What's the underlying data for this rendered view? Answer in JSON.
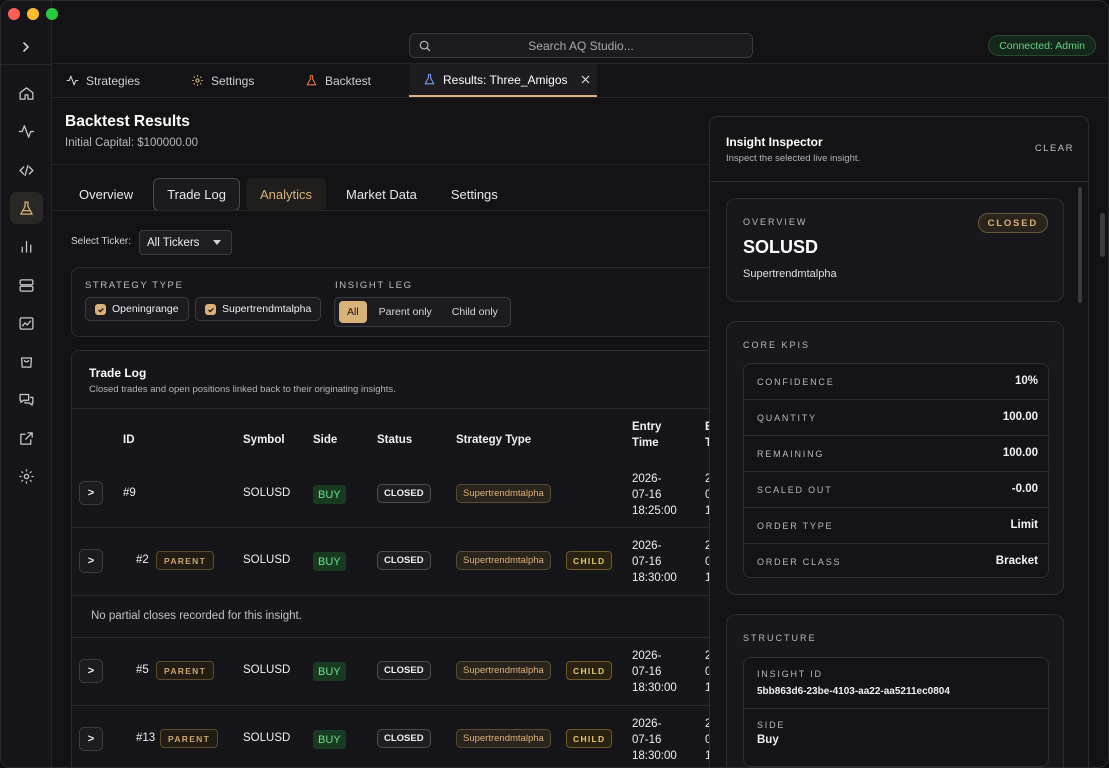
{
  "sidebar": {
    "toggle_icon": "chevron-right-icon",
    "items": [
      {
        "icon": "home-icon"
      },
      {
        "icon": "activity-icon"
      },
      {
        "icon": "code-icon"
      },
      {
        "icon": "flask-icon",
        "active": true
      },
      {
        "icon": "bar-chart-icon"
      },
      {
        "icon": "server-icon"
      },
      {
        "icon": "line-chart-icon"
      },
      {
        "icon": "shopping-bag-icon"
      },
      {
        "icon": "chat-icon"
      },
      {
        "icon": "external-link-icon"
      },
      {
        "icon": "gear-icon"
      }
    ]
  },
  "topbar": {
    "search_placeholder": "Search AQ Studio...",
    "connection": "Connected: Admin"
  },
  "main_tabs": [
    {
      "label": "Strategies",
      "icon": "activity-icon"
    },
    {
      "label": "Settings",
      "icon": "gear-icon"
    },
    {
      "label": "Backtest",
      "icon": "flask-icon"
    },
    {
      "label": "Results: Three_Amigos",
      "icon": "flask-icon",
      "active": true
    }
  ],
  "header": {
    "title": "Backtest Results",
    "subtitle": "Initial Capital: $100000.00"
  },
  "sub_tabs": [
    "Overview",
    "Trade Log",
    "Analytics",
    "Market Data",
    "Settings"
  ],
  "ticker": {
    "label": "Select Ticker:",
    "value": "All Tickers"
  },
  "filters": {
    "strategy_label": "STRATEGY TYPE",
    "strategies": [
      "Openingrange",
      "Supertrendmtalpha"
    ],
    "leg_label": "INSIGHT LEG",
    "legs": [
      "All",
      "Parent only",
      "Child only"
    ]
  },
  "trade_log": {
    "title": "Trade Log",
    "subtitle": "Closed trades and open positions linked back to their originating insights.",
    "headers": {
      "id": "ID",
      "symbol": "Symbol",
      "side": "Side",
      "status": "Status",
      "strategy": "Strategy Type",
      "entry_1": "Entry",
      "entry_2": "Time",
      "exit_1": "E",
      "exit_2": "T"
    },
    "expander": ">",
    "parent_badge": "PARENT",
    "child_badge": "CHILD",
    "empty_note": "No partial closes recorded for this insight.",
    "rows": [
      {
        "id": "#9",
        "symbol": "SOLUSD",
        "side": "BUY",
        "status": "CLOSED",
        "strategy": "Supertrendmtalpha",
        "entry_date": "2026-",
        "entry_md": "07-16",
        "entry_time": "18:25:00",
        "exit_a": "2",
        "exit_b": "0",
        "exit_c": "1"
      },
      {
        "id": "#2",
        "symbol": "SOLUSD",
        "side": "BUY",
        "status": "CLOSED",
        "strategy": "Supertrendmtalpha",
        "entry_date": "2026-",
        "entry_md": "07-16",
        "entry_time": "18:30:00",
        "exit_a": "2",
        "exit_b": "0",
        "exit_c": "1"
      },
      {
        "id": "#5",
        "symbol": "SOLUSD",
        "side": "BUY",
        "status": "CLOSED",
        "strategy": "Supertrendmtalpha",
        "entry_date": "2026-",
        "entry_md": "07-16",
        "entry_time": "18:30:00",
        "exit_a": "2",
        "exit_b": "0",
        "exit_c": "1"
      },
      {
        "id": "#13",
        "symbol": "SOLUSD",
        "side": "BUY",
        "status": "CLOSED",
        "strategy": "Supertrendmtalpha",
        "entry_date": "2026-",
        "entry_md": "07-16",
        "entry_time": "18:30:00",
        "exit_a": "2",
        "exit_b": "0",
        "exit_c": "1"
      }
    ]
  },
  "inspector": {
    "title": "Insight Inspector",
    "subtitle": "Inspect the selected live insight.",
    "clear": "CLEAR",
    "overview_label": "OVERVIEW",
    "status": "CLOSED",
    "symbol": "SOLUSD",
    "strategy": "Supertrendmtalpha",
    "kpi_label": "CORE KPIS",
    "kpis": [
      {
        "k": "CONFIDENCE",
        "v": "10%"
      },
      {
        "k": "QUANTITY",
        "v": "100.00"
      },
      {
        "k": "REMAINING",
        "v": "100.00"
      },
      {
        "k": "SCALED OUT",
        "v": "-0.00"
      },
      {
        "k": "ORDER TYPE",
        "v": "Limit"
      },
      {
        "k": "ORDER CLASS",
        "v": "Bracket"
      }
    ],
    "structure_label": "STRUCTURE",
    "insight_id_label": "INSIGHT ID",
    "insight_id": "5bb863d6-23be-4103-aa22-aa5211ec0804",
    "side_label": "SIDE",
    "side": "Buy"
  }
}
